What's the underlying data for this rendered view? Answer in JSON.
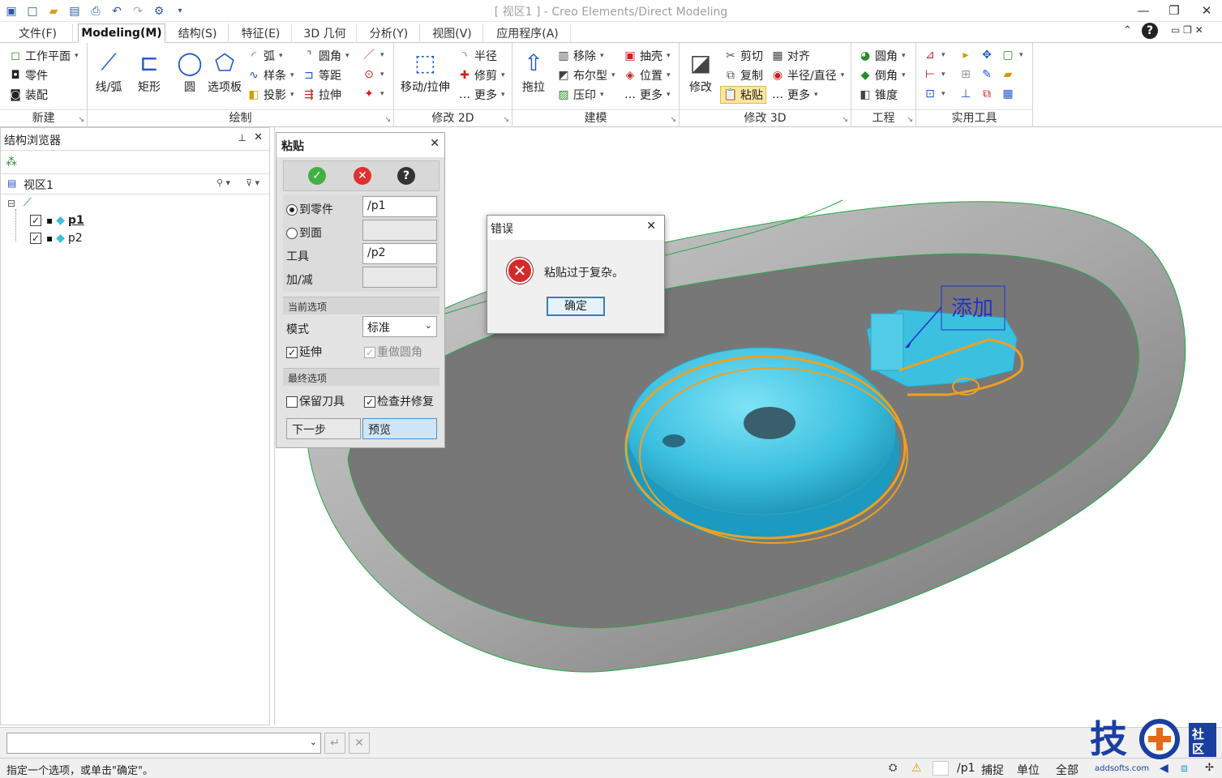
{
  "window": {
    "title": "[ 视区1 ] - Creo Elements/Direct Modeling"
  },
  "menu": {
    "tabs": [
      "文件(F)",
      "Modeling(M)",
      "结构(S)",
      "特征(E)",
      "3D 几何",
      "分析(Y)",
      "视图(V)",
      "应用程序(A)"
    ],
    "active": "Modeling(M)"
  },
  "ribbon": {
    "new": {
      "label": "新建",
      "items": [
        "工作平面",
        "零件",
        "装配"
      ]
    },
    "draw": {
      "label": "绘制",
      "big": [
        "线/弧",
        "矩形",
        "圆",
        "选项板"
      ],
      "small": [
        "弧",
        "样条",
        "投影",
        "圆角",
        "等距",
        "拉伸"
      ]
    },
    "modify2d": {
      "label": "修改 2D",
      "big": "移动/拉伸",
      "small": [
        "半径",
        "修剪",
        "更多"
      ]
    },
    "modeling": {
      "label": "建模",
      "big": "拖拉",
      "small": [
        "移除",
        "布尔型",
        "压印",
        "抽壳",
        "位置",
        "更多"
      ]
    },
    "modify3d": {
      "label": "修改 3D",
      "big": "修改",
      "small": [
        "剪切",
        "复制",
        "粘贴",
        "对齐",
        "半径/直径",
        "更多"
      ]
    },
    "engineering": {
      "label": "工程",
      "small": [
        "圆角",
        "倒角",
        "锥度"
      ]
    },
    "utilities": {
      "label": "实用工具"
    }
  },
  "browser": {
    "title": "结构浏览器",
    "view": "视区1",
    "parts": [
      "p1",
      "p2"
    ]
  },
  "paste_panel": {
    "title": "粘贴",
    "to_part_label": "到零件",
    "to_part_value": "/p1",
    "to_face_label": "到面",
    "tool_label": "工具",
    "tool_value": "/p2",
    "addsub_label": "加/减",
    "current_options": "当前选项",
    "mode_label": "模式",
    "mode_value": "标准",
    "extend_label": "延伸",
    "redo_fillet_label": "重做圆角",
    "final_options": "最终选项",
    "keep_tool_label": "保留刀具",
    "check_repair_label": "检查并修复",
    "next_label": "下一步",
    "preview_label": "预览"
  },
  "error_dialog": {
    "title": "错误",
    "message": "粘贴过于复杂。",
    "ok_label": "确定"
  },
  "viewport": {
    "annotation": "添加"
  },
  "status": {
    "prompt": "指定一个选项，或单击\"确定\"。",
    "part": "/p1",
    "snap": "捕捉",
    "unit": "单位",
    "all": "全部",
    "watermark_sub": "addsofts.com"
  },
  "colors": {
    "part_tool": "#3cc0e0",
    "highlight": "#f0a020",
    "tray": "#7a7a7a",
    "edge": "#22aa44"
  }
}
